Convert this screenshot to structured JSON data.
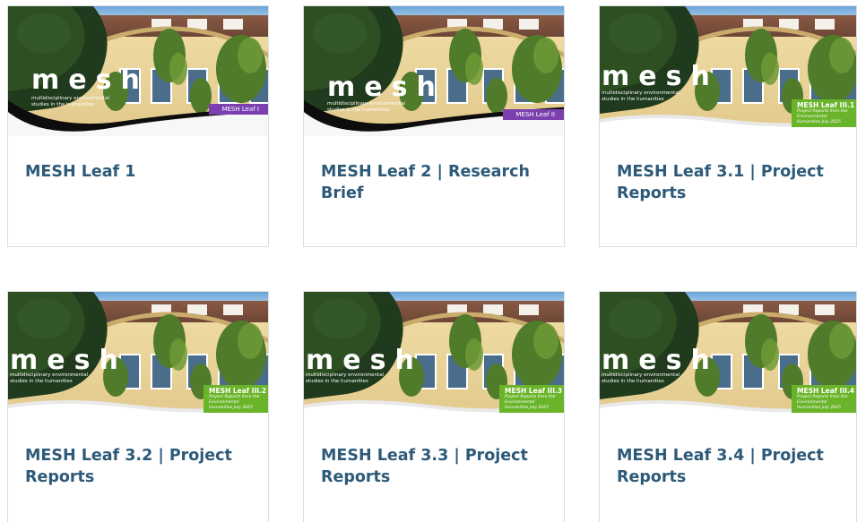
{
  "colors": {
    "title_text": "#2d5a78",
    "card_border": "#d9dde1",
    "tag_purple": "#7b3fb0",
    "tag_green": "#6ab42a"
  },
  "cards": [
    {
      "title": "MESH Leaf 1",
      "logo": "mesh",
      "subtitle": "multidisciplinary environmental studies in the humanities",
      "tag_label": "MESH Leaf I",
      "tag_style": "purple",
      "tag_sub": ""
    },
    {
      "title": "MESH Leaf 2 | Research Brief",
      "logo": "mesh",
      "subtitle": "multidisciplinary environmental studies in the humanities",
      "tag_label": "MESH Leaf II",
      "tag_style": "purple",
      "tag_sub": ""
    },
    {
      "title": "MESH Leaf 3.1 | Project Reports",
      "logo": "mesh",
      "subtitle": "multidisciplinary environmental studies in the humanities",
      "tag_label": "MESH Leaf III.1",
      "tag_style": "green",
      "tag_sub": "Project Reports from the Environmental Humanities July 2025"
    },
    {
      "title": "MESH Leaf 3.2 | Project Reports",
      "logo": "mesh",
      "subtitle": "multidisciplinary environmental studies in the humanities",
      "tag_label": "MESH Leaf III.2",
      "tag_style": "green",
      "tag_sub": "Project Reports from the Environmental Humanities July 2025"
    },
    {
      "title": "MESH Leaf 3.3 | Project Reports",
      "logo": "mesh",
      "subtitle": "multidisciplinary environmental studies in the humanities",
      "tag_label": "MESH Leaf III.3",
      "tag_style": "green",
      "tag_sub": "Project Reports from the Environmental Humanities July 2025"
    },
    {
      "title": "MESH Leaf 3.4 | Project Reports",
      "logo": "mesh",
      "subtitle": "multidisciplinary environmental studies in the humanities",
      "tag_label": "MESH Leaf III.4",
      "tag_style": "green",
      "tag_sub": "Project Reports from the Environmental Humanities July 2025"
    }
  ]
}
